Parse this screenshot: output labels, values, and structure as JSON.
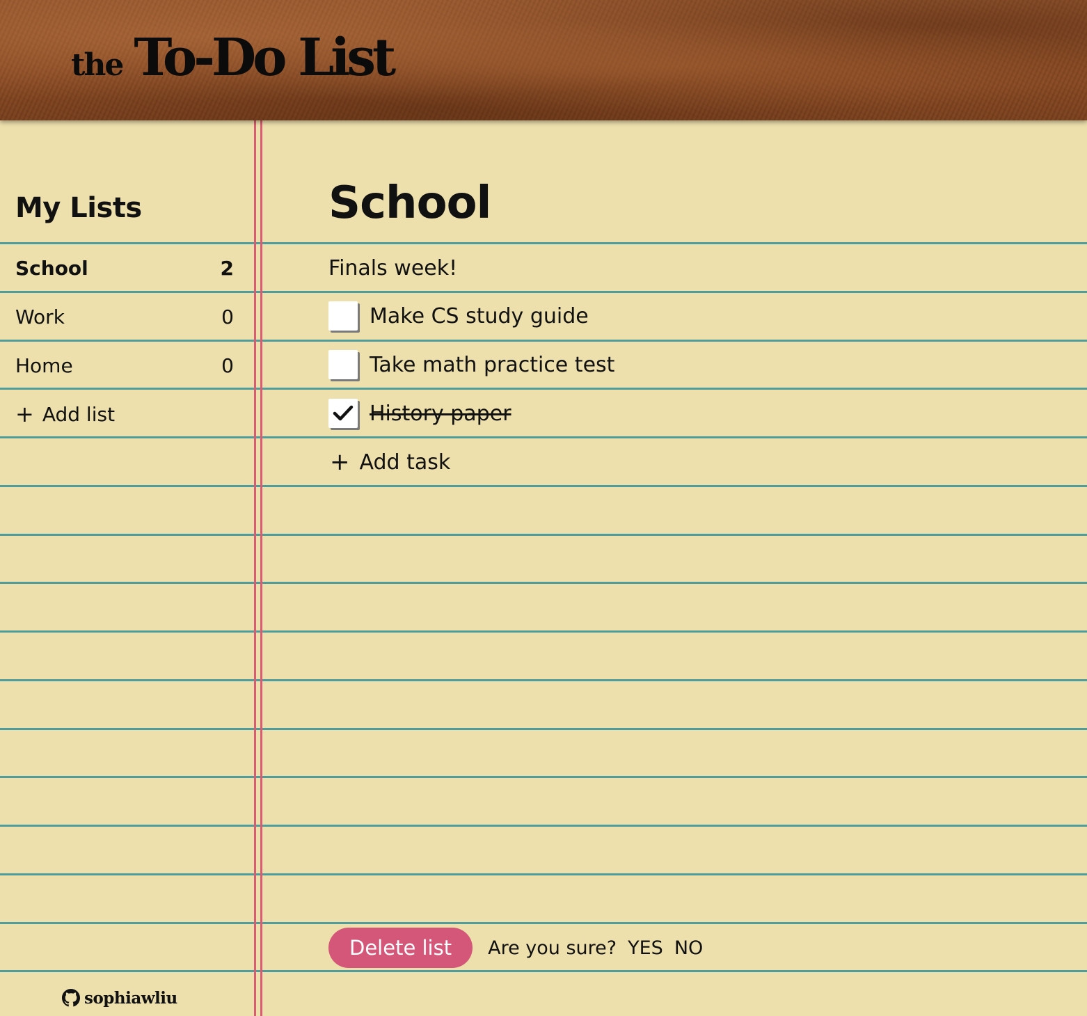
{
  "header": {
    "brand_prefix": "the",
    "brand_title": "To-Do List",
    "background_color": "#8a4a22"
  },
  "sidebar": {
    "heading": "My Lists",
    "lists": [
      {
        "name": "School",
        "count": "2",
        "active": true
      },
      {
        "name": "Work",
        "count": "0",
        "active": false
      },
      {
        "name": "Home",
        "count": "0",
        "active": false
      }
    ],
    "add_list_icon": "+",
    "add_list_label": "Add list"
  },
  "main": {
    "title": "School",
    "description": "Finals week!",
    "tasks": [
      {
        "label": "Make CS study guide",
        "done": false
      },
      {
        "label": "Take math practice test",
        "done": false
      },
      {
        "label": "History paper",
        "done": true
      }
    ],
    "add_task_icon": "+",
    "add_task_label": "Add task",
    "delete_button_label": "Delete list",
    "confirm_text": "Are you sure?",
    "confirm_yes": "YES",
    "confirm_no": "NO"
  },
  "footer": {
    "github_icon": "github-icon",
    "username": "sophiawliu"
  },
  "colors": {
    "paper": "#ede0ad",
    "rule_line": "#4e9c9b",
    "margin_line": "#d95c72",
    "delete_button": "#d4577a"
  }
}
